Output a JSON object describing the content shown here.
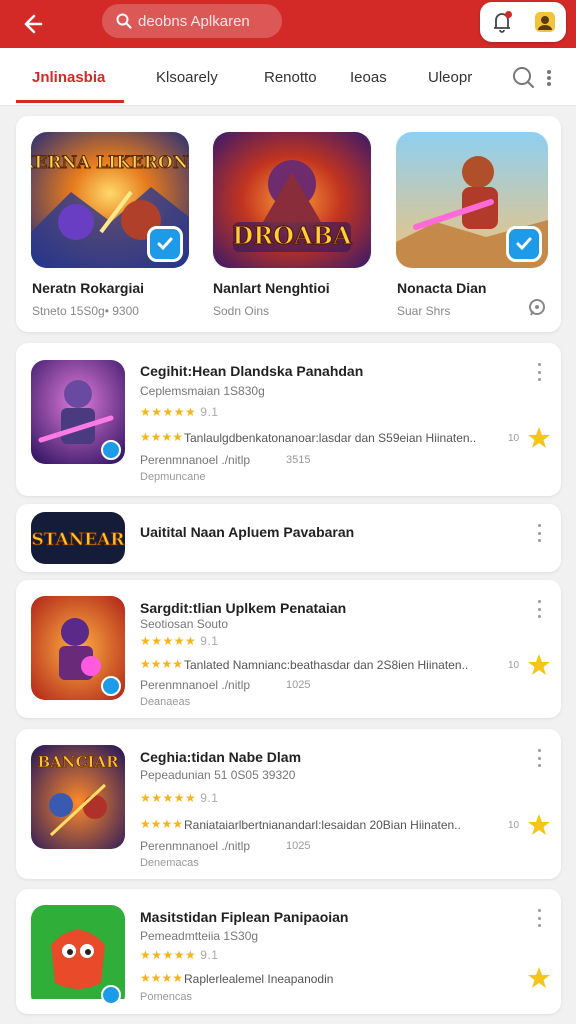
{
  "header": {
    "search_text": "deobns Aplkaren",
    "notif_icon": "bell-icon",
    "profile_icon": "user-icon"
  },
  "tabs": [
    {
      "label": "Jnlinasbia",
      "active": true
    },
    {
      "label": "Klsoarely",
      "active": false
    },
    {
      "label": "Renotto",
      "active": false
    },
    {
      "label": "Ieoas",
      "active": false
    },
    {
      "label": "Uleopr",
      "active": false
    }
  ],
  "featured": [
    {
      "title": "Neratn Rokargiai",
      "sub": "Stneto 15S0g• 9300",
      "art": "EXERNA LIKERONIN"
    },
    {
      "title": "Nanlart Nenghtioi",
      "sub": "Sodn Oins",
      "art": "DROABA"
    },
    {
      "title": "Nonacta Dian",
      "sub": "Suar Shrs"
    }
  ],
  "apps": [
    {
      "title": "Cegihit:Hean Dlandska Panahdan",
      "sub": "Ceplemsmaian 1S830g",
      "rating": "★★★★★ 9.1",
      "rating_num": "9.1",
      "desc": "Tanlaulgdbenkatonanoar:lasdar dan S59eian Hiinaten..",
      "meta": "Perenmnanoel ./nitlp",
      "meta2": "3515",
      "foot": "Depmuncane",
      "fav_num": "10"
    },
    {
      "title": "Uaitital Naan Apluem Pavabaran",
      "art": "STANEAR"
    },
    {
      "title": "Sargdit:tlian Uplkem Penataian",
      "sub": "Seotiosan Souto",
      "rating_num": "9.1",
      "desc": "Tanlated Namnianc:beathasdar dan 2S8ien Hiinaten..",
      "meta": "Perenmnanoel ./nitlp",
      "meta2": "1025",
      "foot": "Deanaeas",
      "fav_num": "10"
    },
    {
      "title": "Ceghia:tidan Nabe Dlam",
      "sub": "Pepeadunian 51 0S05 39320",
      "rating_num": "9.1",
      "desc": "Raniataiarlbertnianandarl:lesaidan 20Bian Hiinaten..",
      "meta": "Perenmnanoel ./nitlp",
      "meta2": "1025",
      "foot": "Denemacas",
      "fav_num": "10",
      "art": "BANCIAR"
    },
    {
      "title": "Masitstidan Fiplean Panipaoian",
      "sub": "Pemeadmtteiia 1S30g",
      "rating_num": "9.1",
      "desc": "Raplerlealemel Ineapanodin",
      "foot": "Pomencas"
    }
  ]
}
